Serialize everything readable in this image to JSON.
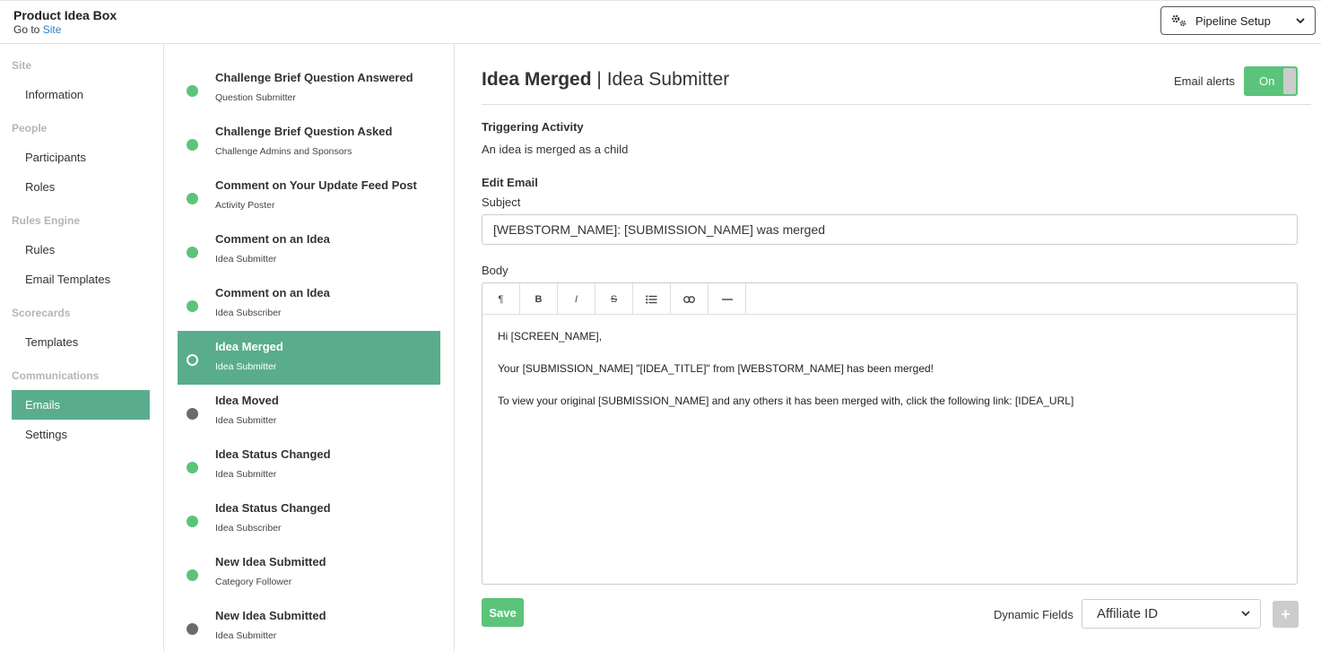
{
  "header": {
    "app_title": "Product Idea Box",
    "goto_prefix": "Go to",
    "goto_link": "Site",
    "pipeline_label": "Pipeline Setup"
  },
  "leftnav": {
    "sections": [
      {
        "title": "Site",
        "items": [
          "Information"
        ]
      },
      {
        "title": "People",
        "items": [
          "Participants",
          "Roles"
        ]
      },
      {
        "title": "Rules Engine",
        "items": [
          "Rules",
          "Email Templates"
        ]
      },
      {
        "title": "Scorecards",
        "items": [
          "Templates"
        ]
      },
      {
        "title": "Communications",
        "items": [
          "Emails",
          "Settings"
        ]
      }
    ],
    "active_item": "Emails"
  },
  "emails": [
    {
      "title": "Challenge Brief Question Answered",
      "recipient": "Question Submitter",
      "status": "active"
    },
    {
      "title": "Challenge Brief Question Asked",
      "recipient": "Challenge Admins and Sponsors",
      "status": "active"
    },
    {
      "title": "Comment on Your Update Feed Post",
      "recipient": "Activity Poster",
      "status": "active"
    },
    {
      "title": "Comment on an Idea",
      "recipient": "Idea Submitter",
      "status": "active"
    },
    {
      "title": "Comment on an Idea",
      "recipient": "Idea Subscriber",
      "status": "active"
    },
    {
      "title": "Idea Merged",
      "recipient": "Idea Submitter",
      "status": "selected"
    },
    {
      "title": "Idea Moved",
      "recipient": "Idea Submitter",
      "status": "inactive"
    },
    {
      "title": "Idea Status Changed",
      "recipient": "Idea Submitter",
      "status": "active"
    },
    {
      "title": "Idea Status Changed",
      "recipient": "Idea Subscriber",
      "status": "active"
    },
    {
      "title": "New Idea Submitted",
      "recipient": "Category Follower",
      "status": "active"
    },
    {
      "title": "New Idea Submitted",
      "recipient": "Idea Submitter",
      "status": "inactive"
    }
  ],
  "main": {
    "title_bold": "Idea Merged",
    "title_sep": "|",
    "title_rest": "Idea Submitter",
    "email_alerts_label": "Email alerts",
    "toggle_label": "On",
    "triggering_activity_label": "Triggering Activity",
    "triggering_activity_value": "An idea is merged as a child",
    "edit_email_label": "Edit Email",
    "subject_label": "Subject",
    "subject_value": "[WEBSTORM_NAME]: [SUBMISSION_NAME] was merged",
    "body_label": "Body",
    "body_lines": [
      "Hi [SCREEN_NAME],",
      "Your [SUBMISSION_NAME] \"[IDEA_TITLE]\" from [WEBSTORM_NAME] has been merged!",
      "To view your original [SUBMISSION_NAME] and any others it has been merged with, click the following link: [IDEA_URL]"
    ],
    "save_label": "Save",
    "dynamic_fields_label": "Dynamic Fields",
    "dynamic_fields_selected": "Affiliate ID",
    "plus_label": "+"
  },
  "toolbar_icons": [
    "paragraph-icon",
    "bold-icon",
    "italic-icon",
    "strikethrough-icon",
    "bullet-list-icon",
    "link-icon",
    "horizontal-rule-icon"
  ],
  "colors": {
    "accent": "#5aad8c",
    "status_active": "#5bc47a",
    "status_inactive": "#6b6b6b",
    "link": "#2b7ec9"
  }
}
